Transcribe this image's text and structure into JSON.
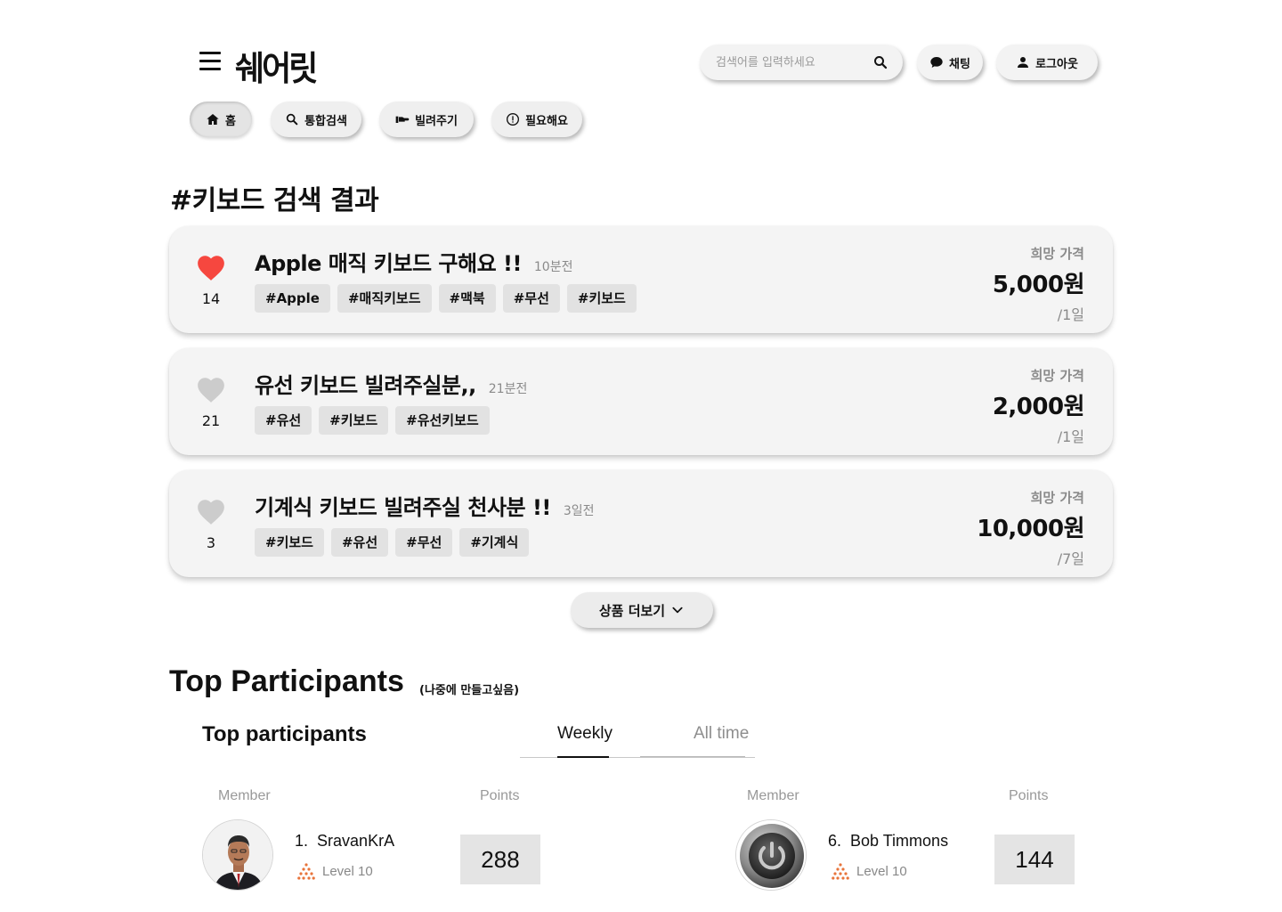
{
  "header": {
    "logo": "쉐어릿",
    "search_placeholder": "검색어를 입력하세요",
    "chat_label": "채팅",
    "logout_label": "로그아웃"
  },
  "nav": {
    "home": "홈",
    "search": "통합검색",
    "lend": "빌려주기",
    "need": "필요해요"
  },
  "section_title": "#키보드 검색 결과",
  "posts": [
    {
      "liked": true,
      "likes": "14",
      "title": "Apple 매직 키보드 구해요 !!",
      "time": "10분전",
      "tags": [
        "#Apple",
        "#매직키보드",
        "#맥북",
        "#무선",
        "#키보드"
      ],
      "price_label": "희망 가격",
      "price": "5,000원",
      "period": "/1일"
    },
    {
      "liked": false,
      "likes": "21",
      "title": "유선 키보드 빌려주실분,,",
      "time": "21분전",
      "tags": [
        "#유선",
        "#키보드",
        "#유선키보드"
      ],
      "price_label": "희망 가격",
      "price": "2,000원",
      "period": "/1일"
    },
    {
      "liked": false,
      "likes": "3",
      "title": "기계식 키보드 빌려주실 천사분 !!",
      "time": "3일전",
      "tags": [
        "#키보드",
        "#유선",
        "#무선",
        "#기계식"
      ],
      "price_label": "희망 가격",
      "price": "10,000원",
      "period": "/7일"
    }
  ],
  "more_label": "상품 더보기",
  "colors": {
    "heart_liked": "#f6473f",
    "heart_unliked": "#cccccc",
    "card_bg": "#f4f4f4",
    "tag_bg": "#e2e2e2",
    "level_icon": "#e8743b"
  },
  "top_participants": {
    "heading": "Top Participants",
    "note": "(나중에 만들고싶음)",
    "subheading": "Top participants",
    "tabs": {
      "weekly": "Weekly",
      "all_time": "All time"
    },
    "active_tab": "weekly",
    "col_member": "Member",
    "col_points": "Points",
    "entries": [
      {
        "rank": "1.",
        "name": "SravanKrA",
        "level": "Level 10",
        "points": "288",
        "avatar": "person-photo"
      },
      {
        "rank": "6.",
        "name": "Bob Timmons",
        "level": "Level 10",
        "points": "144",
        "avatar": "power-button"
      }
    ]
  }
}
